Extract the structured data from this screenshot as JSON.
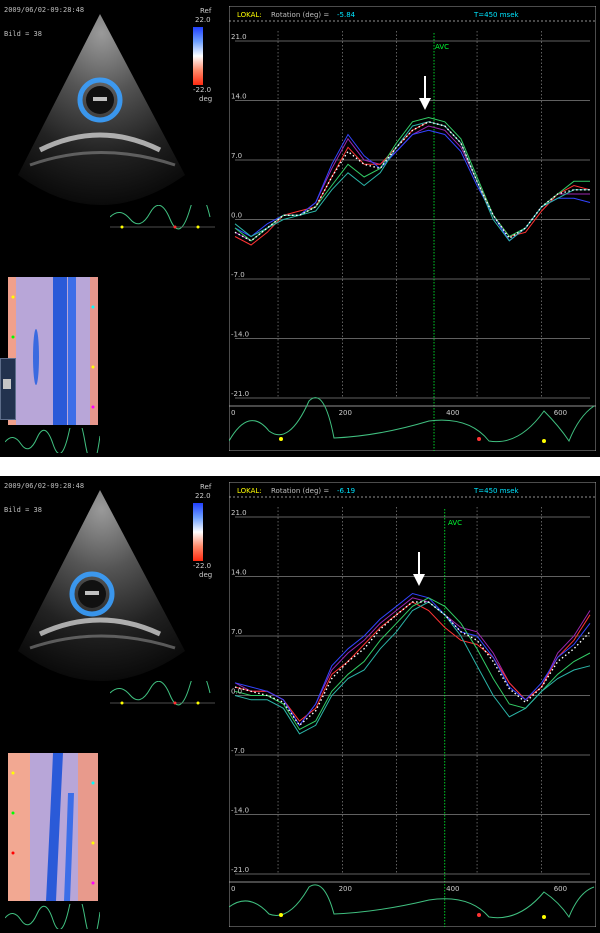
{
  "colors": {
    "accent_yellow": "#ffff00",
    "cyan": "#00e5ff",
    "avc_green": "#00ff33",
    "ecg_green": "#40c080",
    "grid": "#bfbfbf"
  },
  "panels": [
    {
      "timestamp": "2009/06/02-09:28:48",
      "frame_label": "Bild = 38",
      "colorbar": {
        "label_top": "Ref",
        "max": "22.0",
        "min": "-22.0",
        "unit": "deg"
      },
      "header": {
        "mode": "LOKAL:",
        "measure": "Rotation (deg) =",
        "value": "-5.84",
        "time": "T=450 msek"
      },
      "avc_label": "AVC"
    },
    {
      "timestamp": "2009/06/02-09:28:48",
      "frame_label": "Bild = 38",
      "colorbar": {
        "label_top": "Ref",
        "max": "22.0",
        "min": "-22.0",
        "unit": "deg"
      },
      "header": {
        "mode": "LOKAL:",
        "measure": "Rotation (deg) =",
        "value": "-6.19",
        "time": "T=450 msek"
      },
      "avc_label": "AVC"
    }
  ],
  "chart_data": [
    {
      "type": "line",
      "title": "LOKAL: Rotation (deg) = -5.84   T=450 msek",
      "xlabel": "",
      "ylabel": "",
      "xlim": [
        0,
        660
      ],
      "ylim": [
        -21.0,
        21.0
      ],
      "x_ticks": [
        "0",
        "200",
        "400",
        "600"
      ],
      "y_ticks": [
        "21.0",
        "14.0",
        "7.0",
        "0.0",
        "-7.0",
        "-14.0",
        "-21.0"
      ],
      "avc_x": 370,
      "x": [
        0,
        30,
        60,
        90,
        120,
        150,
        180,
        210,
        240,
        270,
        300,
        330,
        360,
        390,
        420,
        450,
        480,
        510,
        540,
        570,
        600,
        630,
        660
      ],
      "series": [
        {
          "color": "#9c27b0",
          "values": [
            -1.5,
            -2.5,
            -1.0,
            0.5,
            0.5,
            2.0,
            6.0,
            9.5,
            7.0,
            6.5,
            8.0,
            10.0,
            11.0,
            10.5,
            8.5,
            4.5,
            0.5,
            -2.5,
            -1.0,
            1.5,
            3.0,
            3.0,
            3.0
          ]
        },
        {
          "color": "#ff3333",
          "values": [
            -2.0,
            -3.0,
            -1.5,
            0.5,
            1.0,
            1.5,
            5.0,
            8.5,
            6.5,
            6.5,
            8.5,
            10.5,
            11.5,
            11.0,
            9.0,
            4.5,
            0.5,
            -2.0,
            -1.5,
            1.0,
            3.0,
            4.0,
            3.5
          ]
        },
        {
          "color": "#3344ff",
          "values": [
            -1.0,
            -2.0,
            -0.5,
            0.5,
            0.5,
            2.0,
            6.5,
            10.0,
            7.5,
            6.0,
            8.0,
            10.0,
            10.5,
            10.0,
            8.0,
            4.0,
            0.5,
            -2.5,
            -1.0,
            1.5,
            2.5,
            2.5,
            2.0
          ]
        },
        {
          "color": "#33cc66",
          "values": [
            -1.0,
            -2.5,
            -1.0,
            0.5,
            0.5,
            1.5,
            4.0,
            6.5,
            5.0,
            6.0,
            9.0,
            11.5,
            12.0,
            11.5,
            9.5,
            5.0,
            0.5,
            -2.0,
            -1.0,
            1.5,
            3.0,
            4.5,
            4.5
          ]
        },
        {
          "color": "#2bb5a8",
          "values": [
            -0.5,
            -2.0,
            -1.0,
            0.0,
            0.5,
            1.0,
            3.5,
            5.5,
            4.0,
            5.5,
            8.5,
            11.0,
            11.5,
            11.0,
            9.0,
            4.5,
            0.0,
            -2.5,
            -1.0,
            1.5,
            2.5,
            3.5,
            3.5
          ]
        },
        {
          "color": "#ffffff",
          "dashed": true,
          "values": [
            -1.5,
            -2.5,
            -1.0,
            0.5,
            0.5,
            1.5,
            5.0,
            8.0,
            6.5,
            6.0,
            8.5,
            10.5,
            11.5,
            11.0,
            9.0,
            4.5,
            0.5,
            -2.2,
            -1.0,
            1.5,
            3.0,
            3.5,
            3.5
          ]
        }
      ]
    },
    {
      "type": "line",
      "title": "LOKAL: Rotation (deg) = -6.19   T=450 msek",
      "xlabel": "",
      "ylabel": "",
      "xlim": [
        0,
        660
      ],
      "ylim": [
        -21.0,
        21.0
      ],
      "x_ticks": [
        "0",
        "200",
        "400",
        "600"
      ],
      "y_ticks": [
        "21.0",
        "14.0",
        "7.0",
        "0.0",
        "-7.0",
        "-14.0",
        "-21.0"
      ],
      "avc_x": 390,
      "x": [
        0,
        30,
        60,
        90,
        120,
        150,
        180,
        210,
        240,
        270,
        300,
        330,
        360,
        390,
        420,
        450,
        480,
        510,
        540,
        570,
        600,
        630,
        660
      ],
      "series": [
        {
          "color": "#9c27b0",
          "values": [
            1.5,
            0.5,
            0.5,
            -0.5,
            -3.5,
            -1.0,
            3.0,
            5.0,
            6.5,
            8.5,
            10.0,
            11.5,
            11.0,
            9.5,
            8.0,
            7.5,
            5.0,
            1.5,
            -0.5,
            1.0,
            5.0,
            7.0,
            10.0
          ]
        },
        {
          "color": "#ff3333",
          "values": [
            1.0,
            0.5,
            0.5,
            -0.5,
            -3.0,
            -1.5,
            2.5,
            4.0,
            6.0,
            8.0,
            9.5,
            11.0,
            10.0,
            8.0,
            6.5,
            6.0,
            4.5,
            1.5,
            -0.5,
            1.0,
            4.5,
            6.5,
            9.5
          ]
        },
        {
          "color": "#3344ff",
          "values": [
            1.5,
            1.0,
            0.5,
            -0.5,
            -3.5,
            -1.0,
            3.5,
            5.5,
            7.0,
            9.0,
            10.5,
            12.0,
            11.5,
            9.5,
            7.5,
            7.0,
            4.5,
            1.0,
            -0.5,
            1.5,
            4.5,
            6.0,
            8.5
          ]
        },
        {
          "color": "#33cc66",
          "values": [
            0.5,
            0.0,
            0.0,
            -1.0,
            -4.0,
            -3.0,
            0.5,
            2.5,
            4.0,
            6.5,
            8.5,
            10.5,
            11.5,
            10.5,
            8.5,
            5.5,
            2.0,
            -1.0,
            -1.5,
            0.5,
            2.5,
            4.0,
            5.0
          ]
        },
        {
          "color": "#2bb5a8",
          "values": [
            0.0,
            -0.5,
            -0.5,
            -1.5,
            -4.5,
            -3.5,
            0.0,
            2.0,
            3.0,
            5.5,
            7.5,
            10.0,
            11.0,
            9.5,
            7.0,
            3.5,
            0.0,
            -2.5,
            -1.5,
            0.5,
            2.0,
            3.0,
            3.5
          ]
        },
        {
          "color": "#ffffff",
          "dashed": true,
          "values": [
            1.0,
            0.5,
            0.0,
            -0.8,
            -3.5,
            -1.8,
            2.0,
            4.0,
            5.5,
            7.8,
            9.5,
            11.0,
            11.0,
            9.5,
            7.5,
            6.5,
            4.0,
            0.8,
            -0.8,
            1.0,
            4.0,
            5.5,
            7.5
          ]
        }
      ]
    }
  ]
}
